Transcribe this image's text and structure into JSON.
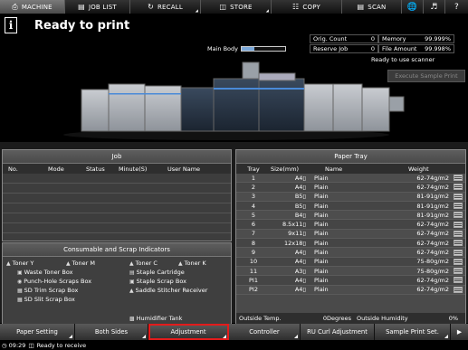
{
  "tabs": [
    {
      "label": "MACHINE",
      "icon": "printer-icon"
    },
    {
      "label": "JOB LIST",
      "icon": "list-icon"
    },
    {
      "label": "RECALL",
      "icon": "recall-icon"
    },
    {
      "label": "STORE",
      "icon": "store-icon"
    },
    {
      "label": "COPY",
      "icon": "copy-icon"
    },
    {
      "label": "SCAN",
      "icon": "scan-icon"
    }
  ],
  "header": {
    "status": "Ready to print",
    "main_body": "Main Body",
    "orig_count_label": "Orig. Count",
    "orig_count_value": "0",
    "reserve_job_label": "Reserve Job",
    "reserve_job_value": "0",
    "memory_label": "Memory",
    "memory_value": "99.999%",
    "file_amount_label": "File Amount",
    "file_amount_value": "99.998%",
    "ready_scanner": "Ready to use scanner",
    "execute_sample": "Execute Sample Print"
  },
  "job": {
    "title": "Job",
    "columns": [
      "No.",
      "Mode",
      "Status",
      "Minute(S)",
      "User Name"
    ]
  },
  "tray": {
    "title": "Paper Tray",
    "columns": [
      "Tray",
      "Size(mm)",
      "Name",
      "Weight"
    ],
    "rows": [
      {
        "tray": "1",
        "size": "A4▯",
        "name": "Plain",
        "weight": "62-74g/m2"
      },
      {
        "tray": "2",
        "size": "A4▯",
        "name": "Plain",
        "weight": "62-74g/m2"
      },
      {
        "tray": "3",
        "size": "B5▯",
        "name": "Plain",
        "weight": "81-91g/m2"
      },
      {
        "tray": "4",
        "size": "B5▯",
        "name": "Plain",
        "weight": "81-91g/m2"
      },
      {
        "tray": "5",
        "size": "B4▯",
        "name": "Plain",
        "weight": "81-91g/m2"
      },
      {
        "tray": "6",
        "size": "8.5x11▯",
        "name": "Plain",
        "weight": "62-74g/m2"
      },
      {
        "tray": "7",
        "size": "9x11▯",
        "name": "Plain",
        "weight": "62-74g/m2"
      },
      {
        "tray": "8",
        "size": "12x18▯",
        "name": "Plain",
        "weight": "62-74g/m2"
      },
      {
        "tray": "9",
        "size": "A4▯",
        "name": "Plain",
        "weight": "62-74g/m2"
      },
      {
        "tray": "10",
        "size": "A4▯",
        "name": "Plain",
        "weight": "75-80g/m2"
      },
      {
        "tray": "11",
        "size": "A3▯",
        "name": "Plain",
        "weight": "75-80g/m2"
      },
      {
        "tray": "PI1",
        "size": "A4▯",
        "name": "Plain",
        "weight": "62-74g/m2"
      },
      {
        "tray": "PI2",
        "size": "A4▯",
        "name": "Plain",
        "weight": "62-74g/m2"
      }
    ],
    "outside_temp_label": "Outside Temp.",
    "outside_temp_value": "0Degrees",
    "outside_humidity_label": "Outside Humidity",
    "outside_humidity_value": "0%"
  },
  "consumables": {
    "title": "Consumable and Scrap Indicators",
    "toner_y": "Toner Y",
    "toner_m": "Toner M",
    "toner_c": "Toner C",
    "toner_k": "Toner K",
    "waste_toner": "Waste Toner Box",
    "staple_cartridge": "Staple Cartridge",
    "punch_hole": "Punch-Hole Scraps Box",
    "staple_scrap": "Staple Scrap Box",
    "sd_trim": "SD Trim Scrap Box",
    "saddle_stitcher": "Saddle Stitcher Receiver",
    "sd_slit": "SD Slit Scrap Box",
    "humidifier": "Humidifier Tank"
  },
  "buttons": {
    "paper_setting": "Paper Setting",
    "both_sides": "Both Sides",
    "adjustment": "Adjustment",
    "controller": "Controller",
    "ru_curl": "RU Curl Adjustment",
    "sample_print": "Sample Print Set.",
    "next": "▶"
  },
  "status_bar": {
    "time": "09:29",
    "message": "Ready to receive"
  },
  "colors": {
    "highlight": "#e21b1b",
    "active_tab": "#6a6a6a",
    "panel": "#4a4a4a"
  }
}
